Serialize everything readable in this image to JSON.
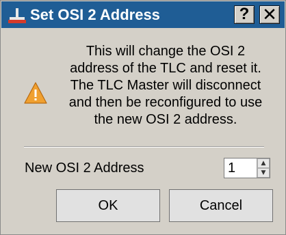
{
  "window": {
    "title": "Set OSI 2 Address",
    "help_label": "?",
    "close_label": "✕"
  },
  "icons": {
    "app": "tlc-app-icon",
    "warning": "warning-icon"
  },
  "message": "This will change the OSI 2\naddress of the TLC and reset it.\nThe TLC Master will disconnect\nand then be reconfigured to use\nthe new OSI 2 address.",
  "field": {
    "label": "New OSI 2 Address",
    "value": "1"
  },
  "buttons": {
    "ok": "OK",
    "cancel": "Cancel"
  },
  "colors": {
    "titlebar": "#1f5d95",
    "dialog_bg": "#d4d0c8",
    "warning": "#f0a030"
  }
}
